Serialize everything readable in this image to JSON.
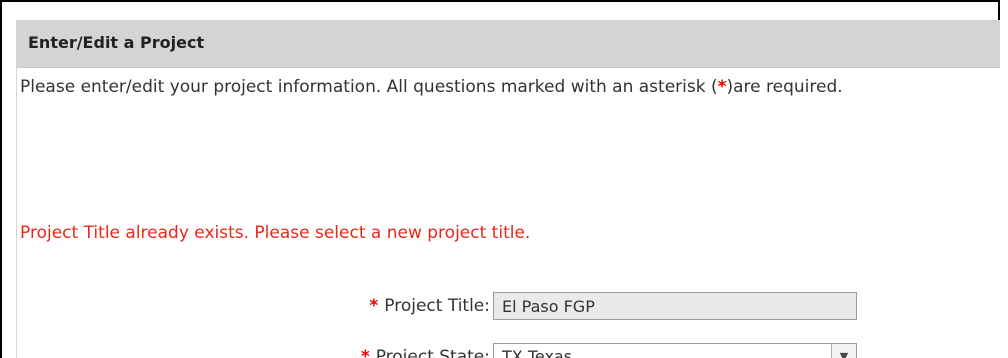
{
  "panel": {
    "title": "Enter/Edit a Project"
  },
  "intro": {
    "text_before": "Please enter/edit your project information.  All questions marked with an asterisk (",
    "asterisk": "*",
    "text_after": ")are required."
  },
  "error": {
    "message": "Project Title already exists. Please select a new project title."
  },
  "form": {
    "required_marker": "*",
    "project_title": {
      "label": "Project Title:",
      "value": "El Paso FGP"
    },
    "project_state": {
      "label": "Project State:",
      "selected": "TX Texas",
      "arrow_icon": "chevron-down-icon"
    }
  }
}
